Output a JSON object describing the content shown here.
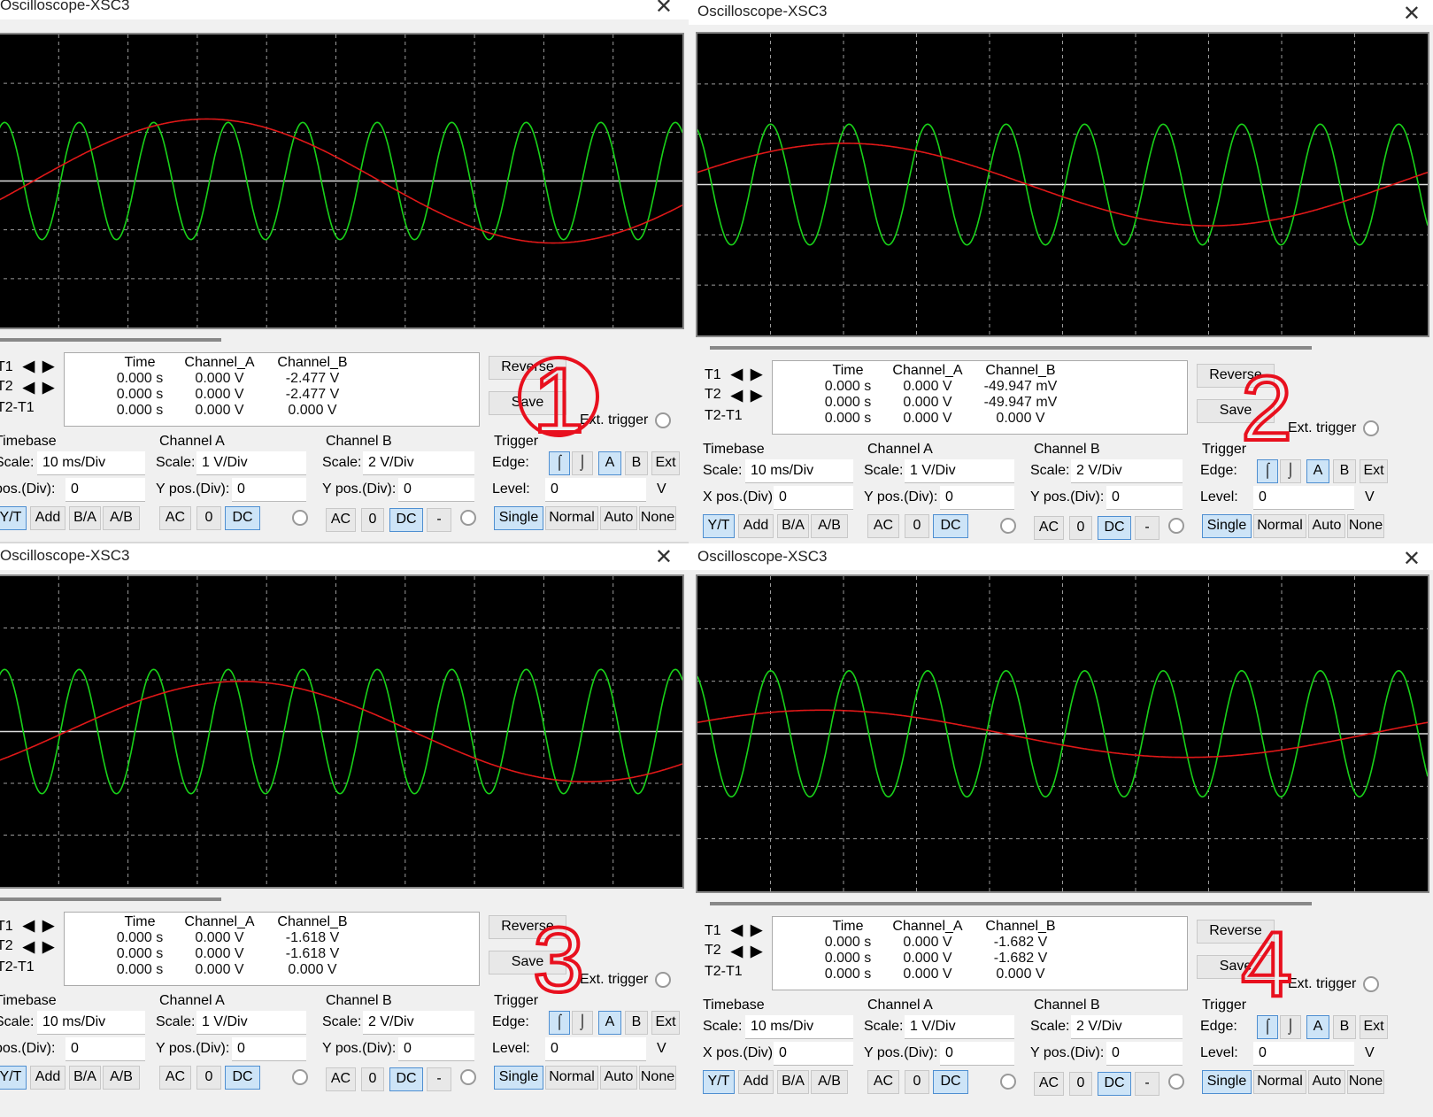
{
  "windows": [
    {
      "id": "w1",
      "title": "Oscilloscope-XSC3",
      "close_glyph": "✕",
      "ch_b_t1": "-2.477 V",
      "ch_b_t2": "-2.477 V",
      "xpos_label": "pos.(Div):",
      "annot": "1"
    },
    {
      "id": "w2",
      "title": "Oscilloscope-XSC3",
      "close_glyph": "✕",
      "ch_b_t1": "-49.947 mV",
      "ch_b_t2": "-49.947 mV",
      "xpos_label": "X pos.(Div):",
      "annot": "2"
    },
    {
      "id": "w3",
      "title": "Oscilloscope-XSC3",
      "close_glyph": "✕",
      "ch_b_t1": "-1.618 V",
      "ch_b_t2": "-1.618 V",
      "xpos_label": "pos.(Div):",
      "annot": "3"
    },
    {
      "id": "w4",
      "title": "Oscilloscope-XSC3",
      "close_glyph": "✕",
      "ch_b_t1": "-1.682 V",
      "ch_b_t2": "-1.682 V",
      "xpos_label": "X pos.(Div):",
      "annot": "4"
    }
  ],
  "measure": {
    "headers": [
      "Time",
      "Channel_A",
      "Channel_B"
    ],
    "rows": [
      "T1",
      "T2",
      "T2-T1"
    ],
    "time": "0.000 s",
    "ch_a": "0.000 V",
    "ch_b_diff": "0.000 V"
  },
  "buttons": {
    "reverse": "Reverse",
    "save": "Save",
    "ext_trigger": "Ext. trigger"
  },
  "timebase": {
    "title": "Timebase",
    "scale_label": "Scale:",
    "scale": "10 ms/Div",
    "xpos": "0",
    "modes": [
      "Y/T",
      "Add",
      "B/A",
      "A/B"
    ]
  },
  "channel_a": {
    "title": "Channel A",
    "scale_label": "Scale:",
    "scale": "1  V/Div",
    "ypos_label": "Y pos.(Div):",
    "ypos": "0",
    "coupling": [
      "AC",
      "0",
      "DC"
    ]
  },
  "channel_b": {
    "title": "Channel B",
    "scale_label": "Scale:",
    "scale": "2  V/Div",
    "ypos_label": "Y pos.(Div):",
    "ypos": "0",
    "coupling": [
      "AC",
      "0",
      "DC",
      "-"
    ]
  },
  "trigger": {
    "title": "Trigger",
    "edge_label": "Edge:",
    "edge_rise": "⌠",
    "edge_fall": "⌡",
    "sources": [
      "A",
      "B",
      "Ext"
    ],
    "level_label": "Level:",
    "level": "0",
    "unit": "V",
    "modes": [
      "Single",
      "Normal",
      "Auto",
      "None"
    ]
  },
  "colors": {
    "channel_a": "#19d219",
    "channel_b": "#e01818",
    "annotation": "#e8101e",
    "screen": "#000000",
    "grid": "#9a9a9a"
  },
  "icons": {
    "t_left": "◀",
    "t_right": "▶"
  },
  "traces": [
    {
      "a_amp": 1.2,
      "a_per": 32.5,
      "a_ph": -6,
      "b_amp": 1.27,
      "b_per": 5.0,
      "b_ph": -0.4
    },
    {
      "a_amp": 1.2,
      "a_per": 32.5,
      "a_ph": 2,
      "b_amp": 0.82,
      "b_per": 3.4,
      "b_ph": 0.3
    },
    {
      "a_amp": 1.2,
      "a_per": 32.5,
      "a_ph": -6,
      "b_amp": 0.97,
      "b_per": 3.9,
      "b_ph": -0.7
    },
    {
      "a_amp": 1.2,
      "a_per": 32.5,
      "a_ph": 2,
      "b_amp": 0.45,
      "b_per": 2.7,
      "b_ph": 0.5
    }
  ]
}
